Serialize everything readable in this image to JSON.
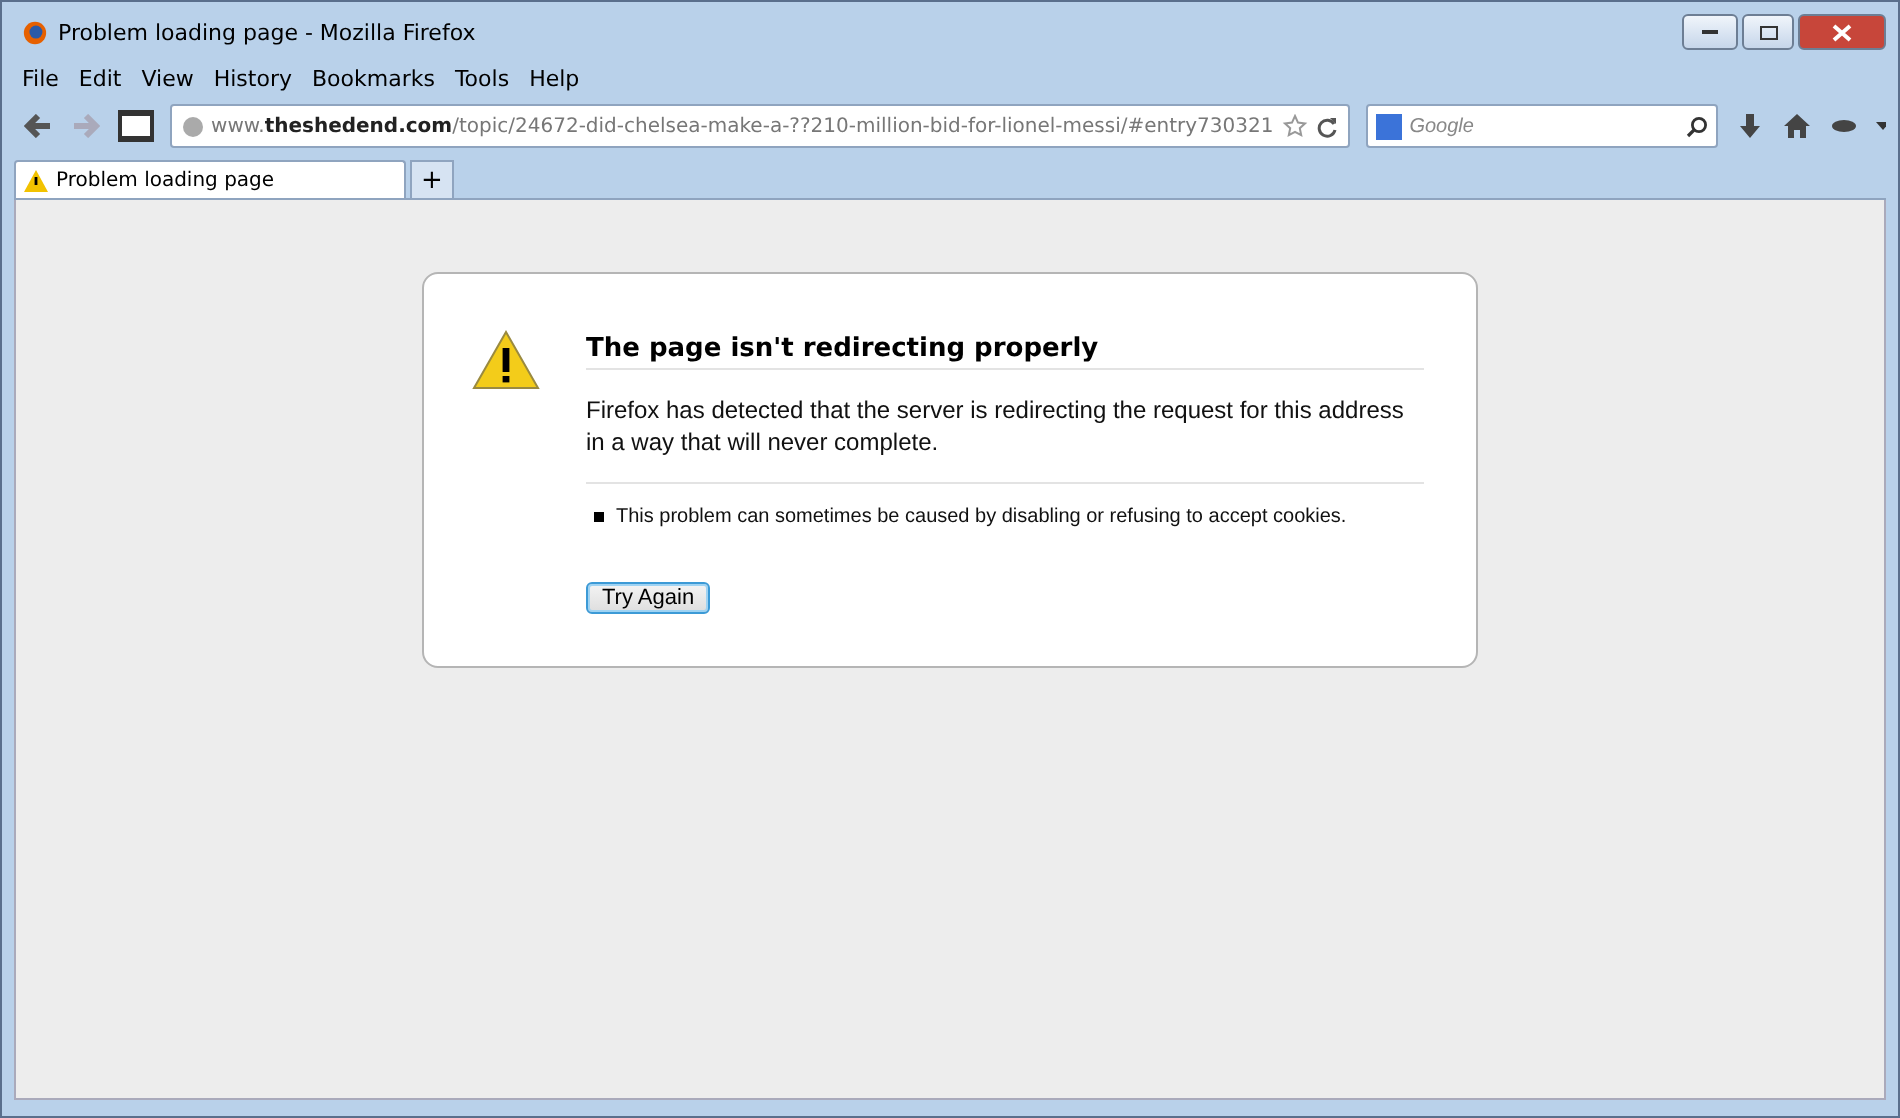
{
  "window": {
    "title": "Problem loading page - Mozilla Firefox"
  },
  "menu": [
    "File",
    "Edit",
    "View",
    "History",
    "Bookmarks",
    "Tools",
    "Help"
  ],
  "address": {
    "url": "www.**theshedend.com**/topic/24672-did-chelsea-make-a-??210-million-bid-for-lionel-messi/#entry730321"
  },
  "search": {
    "placeholder": "Google"
  },
  "tabs": [
    {
      "label": "Problem loading page",
      "selected": true
    }
  ],
  "new_tab": "+",
  "error": {
    "title": "The page isn't redirecting properly",
    "message": "Firefox has detected that the server is redirecting the request for this address in a way that will never complete.",
    "hints": [
      "This problem can sometimes be caused by disabling or refusing to accept cookies."
    ],
    "button": "Try Again"
  }
}
